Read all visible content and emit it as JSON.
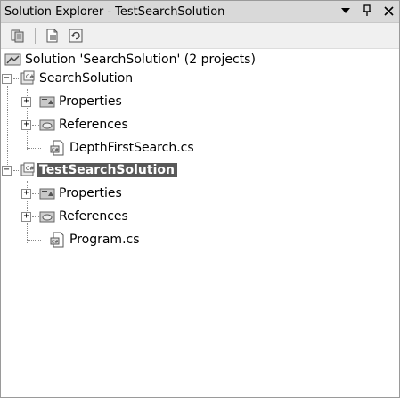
{
  "window": {
    "title": "Solution Explorer - TestSearchSolution",
    "dropdown_icon": "dropdown-arrow-icon",
    "pin_icon": "pin-icon",
    "close_icon": "close-icon"
  },
  "toolbar": {
    "buttons": [
      {
        "name": "show-all-files-button",
        "icon": "show-all-files-icon"
      },
      {
        "name": "properties-button",
        "icon": "properties-icon"
      },
      {
        "name": "refresh-button",
        "icon": "refresh-icon"
      }
    ]
  },
  "tree": {
    "solution": {
      "label": "Solution 'SearchSolution' (2 projects)"
    },
    "projects": [
      {
        "label": "SearchSolution",
        "expanded": true,
        "selected": false,
        "children": [
          {
            "label": "Properties",
            "type": "folder",
            "expandable": true
          },
          {
            "label": "References",
            "type": "references",
            "expandable": true
          },
          {
            "label": "DepthFirstSearch.cs",
            "type": "file",
            "expandable": false
          }
        ]
      },
      {
        "label": "TestSearchSolution",
        "expanded": true,
        "selected": true,
        "children": [
          {
            "label": "Properties",
            "type": "folder",
            "expandable": true
          },
          {
            "label": "References",
            "type": "references",
            "expandable": true
          },
          {
            "label": "Program.cs",
            "type": "file",
            "expandable": false
          }
        ]
      }
    ]
  }
}
